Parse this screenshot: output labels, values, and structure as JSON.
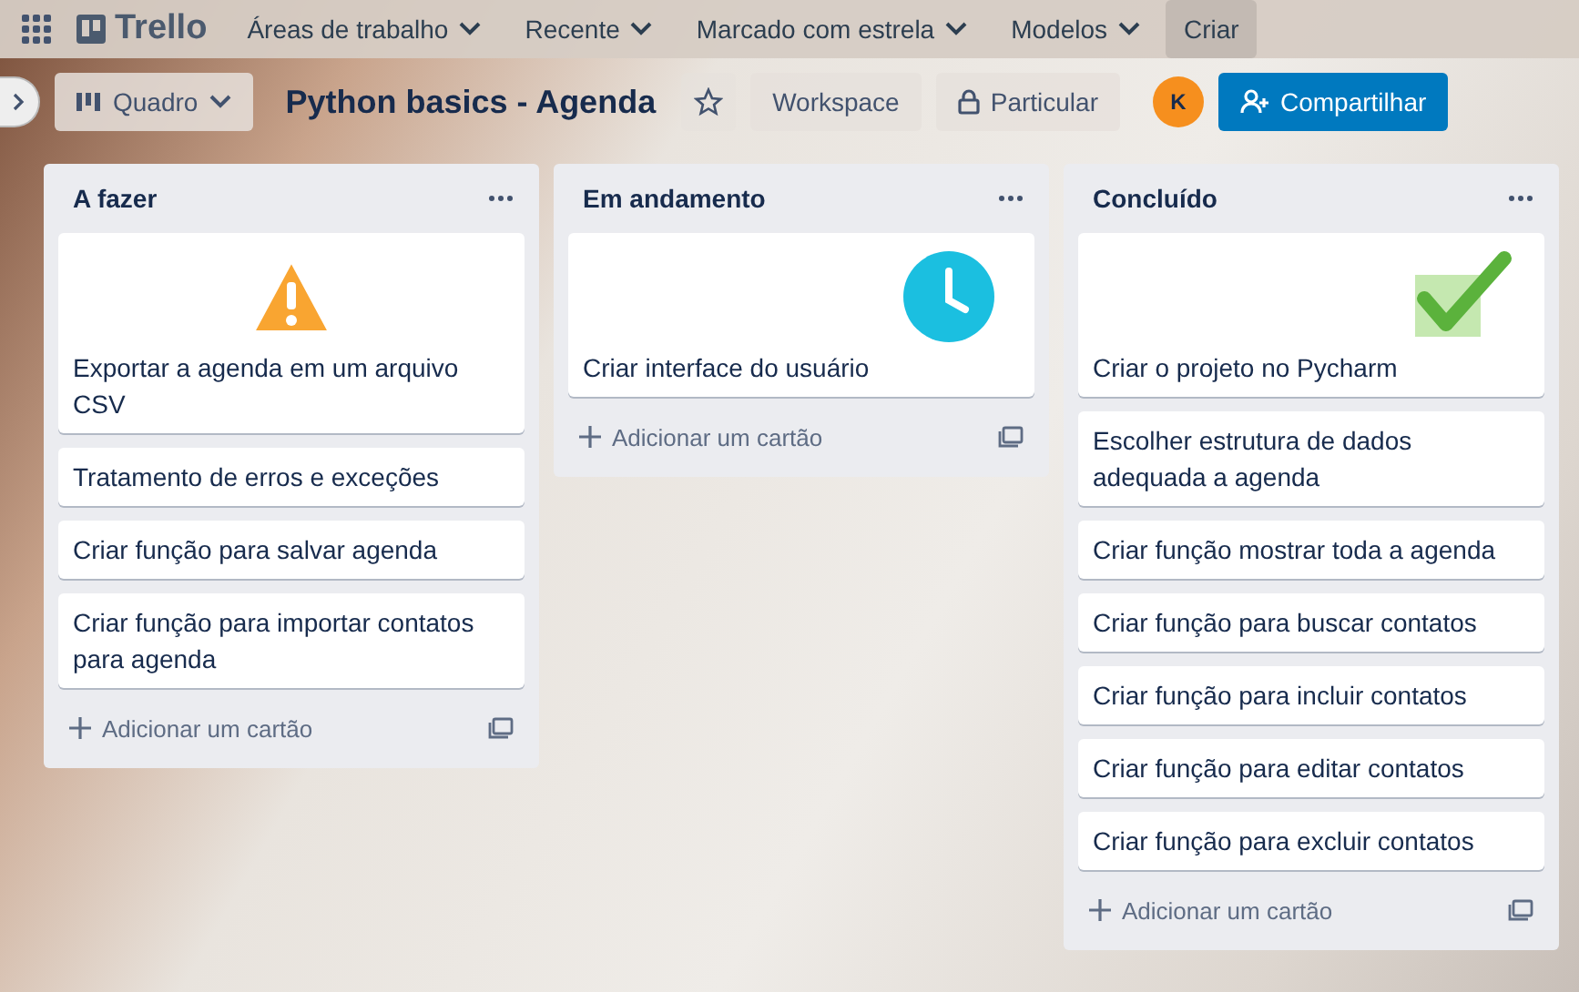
{
  "nav": {
    "logo": "Trello",
    "menus": [
      {
        "label": "Áreas de trabalho"
      },
      {
        "label": "Recente"
      },
      {
        "label": "Marcado com estrela"
      },
      {
        "label": "Modelos"
      }
    ],
    "create": "Criar"
  },
  "board": {
    "view": "Quadro",
    "title": "Python basics - Agenda",
    "starred": false,
    "workspace": "Workspace",
    "visibility": "Particular",
    "avatar": "K",
    "share": "Compartilhar"
  },
  "lists": [
    {
      "title": "A fazer",
      "cards": [
        {
          "text": "Exportar a agenda em um arquivo CSV",
          "kind": "warning"
        },
        {
          "text": "Tratamento de erros e exceções",
          "kind": "plain"
        },
        {
          "text": "Criar função para salvar agenda",
          "kind": "plain"
        },
        {
          "text": "Criar função para importar contatos para agenda",
          "kind": "plain"
        }
      ],
      "add": "Adicionar um cartão"
    },
    {
      "title": "Em andamento",
      "cards": [
        {
          "text": "Criar interface do usuário",
          "kind": "clock"
        }
      ],
      "add": "Adicionar um cartão"
    },
    {
      "title": "Concluído",
      "cards": [
        {
          "text": "Criar o projeto no Pycharm",
          "kind": "check"
        },
        {
          "text": "Escolher estrutura de dados adequada a agenda",
          "kind": "plain"
        },
        {
          "text": "Criar função mostrar toda a agenda",
          "kind": "plain"
        },
        {
          "text": "Criar função para buscar contatos",
          "kind": "plain"
        },
        {
          "text": "Criar função para incluir contatos",
          "kind": "plain"
        },
        {
          "text": "Criar função para editar contatos",
          "kind": "plain"
        },
        {
          "text": "Criar função para excluir contatos",
          "kind": "plain"
        }
      ],
      "add": "Adicionar um cartão"
    }
  ]
}
